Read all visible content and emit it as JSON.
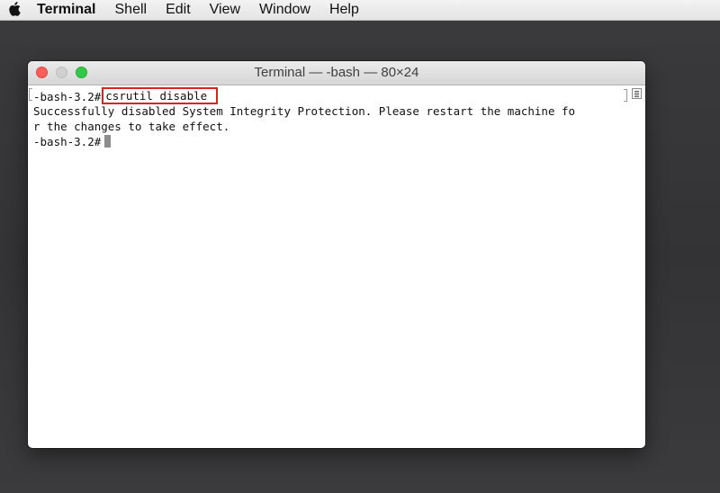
{
  "menubar": {
    "apple_icon": "apple-logo-icon",
    "app_name": "Terminal",
    "items": [
      "Shell",
      "Edit",
      "View",
      "Window",
      "Help"
    ]
  },
  "window": {
    "title": "Terminal — -bash — 80×24",
    "buttons": [
      "close",
      "minimize",
      "zoom"
    ]
  },
  "terminal": {
    "prompt": "-bash-3.2#",
    "command": "csrutil disable",
    "output_lines": [
      "Successfully disabled System Integrity Protection. Please restart the machine fo",
      "r the changes to take effect."
    ],
    "prompt2": "-bash-3.2#"
  },
  "colors": {
    "highlight": "#d9251f",
    "close": "#fc5f57",
    "zoom": "#34c84a"
  }
}
